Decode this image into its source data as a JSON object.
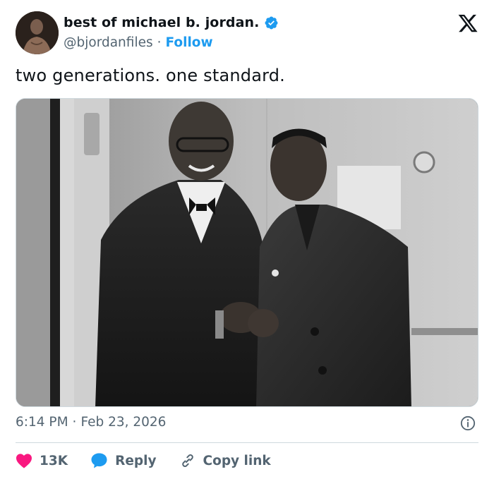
{
  "author": {
    "display_name": "best of michael b. jordan.",
    "handle": "@bjordanfiles",
    "separator": "·",
    "follow_label": "Follow",
    "verified_color": "#1d9bf0"
  },
  "tweet": {
    "text": "two generations. one standard."
  },
  "meta": {
    "time": "6:14 PM",
    "separator": "·",
    "date": "Feb 23, 2026"
  },
  "actions": {
    "like_count": "13K",
    "reply_label": "Reply",
    "copy_link_label": "Copy link"
  },
  "colors": {
    "like": "#f91880",
    "reply": "#1d9bf0",
    "link": "#1d9bf0",
    "secondary_text": "#536471"
  },
  "icons": [
    "x-logo-icon",
    "verified-badge-icon",
    "info-icon",
    "heart-icon",
    "reply-bubble-icon",
    "link-icon"
  ]
}
